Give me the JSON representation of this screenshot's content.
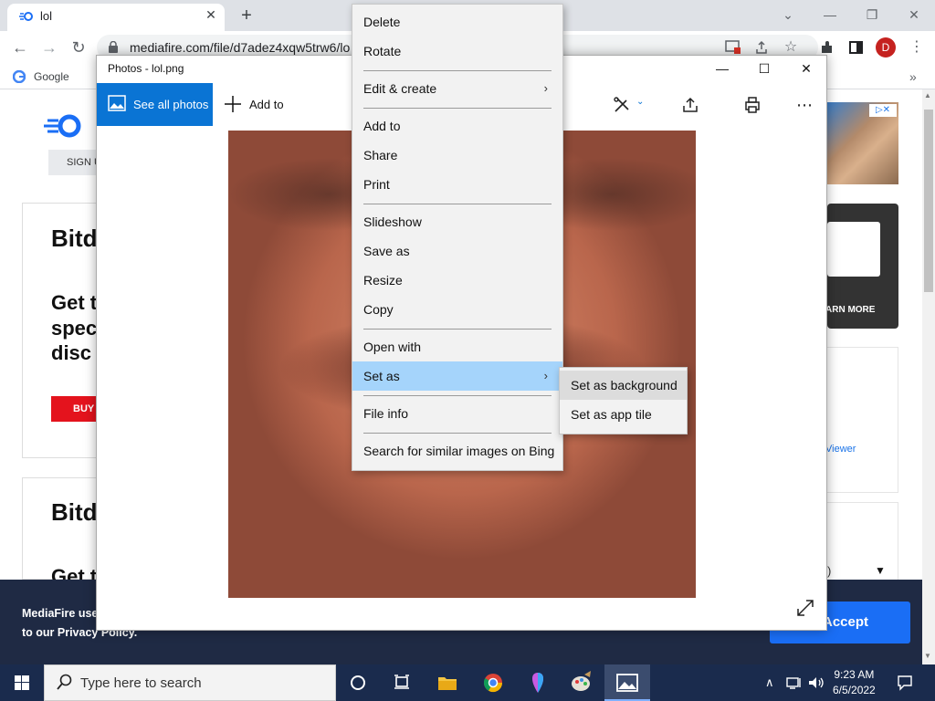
{
  "browser": {
    "tab_title": "lol",
    "tab_close": "✕",
    "new_tab": "+",
    "window_controls": {
      "minimize": "—",
      "restore": "❐",
      "close": "✕",
      "tab_search": "⌄"
    },
    "nav": {
      "back": "←",
      "forward": "→",
      "reload": "↻"
    },
    "url": "mediafire.com/file/d7adez4xqw5trw6/lo",
    "bookmark_google": "Google",
    "bookmarks_more": "»",
    "profile_initial": "D"
  },
  "mediafire": {
    "signup": "SIGN U",
    "card1_heading": "Bitd",
    "card1_body": [
      "Get t",
      "spec",
      "disc"
    ],
    "buy_label": "BUY",
    "card2_heading": "Bitd",
    "card2_body": "Get t",
    "learn_more": "ARN MORE",
    "viewer_link": "Viewer",
    "select_value": ")",
    "cookie_text_line1": "MediaFire use",
    "cookie_text_line2": "to our Privacy Policy.",
    "accept_label": "Accept"
  },
  "photos": {
    "title": "Photos - lol.png",
    "see_all_photos": "See all photos",
    "add_to": "Add to",
    "controls": {
      "minimize": "—",
      "maximize": "☐",
      "close": "✕"
    }
  },
  "context_menu": {
    "items": [
      {
        "label": "Delete"
      },
      {
        "label": "Rotate"
      },
      {
        "label": "Edit & create",
        "submenu": true
      },
      {
        "label": "Add to"
      },
      {
        "label": "Share"
      },
      {
        "label": "Print"
      },
      {
        "label": "Slideshow"
      },
      {
        "label": "Save as"
      },
      {
        "label": "Resize"
      },
      {
        "label": "Copy"
      },
      {
        "label": "Open with"
      },
      {
        "label": "Set as",
        "submenu": true,
        "selected": true
      },
      {
        "label": "File info"
      },
      {
        "label": "Search for similar images on Bing"
      }
    ],
    "chevron": "›"
  },
  "set_as_submenu": {
    "items": [
      "Set as background",
      "Set as app tile"
    ]
  },
  "taskbar": {
    "search_placeholder": "Type here to search",
    "time": "9:23 AM",
    "date": "6/5/2022"
  },
  "colors": {
    "accent": "#0a74d4",
    "menu_selected": "#a5d4fb",
    "taskbar": "#1a2b4d",
    "accept_button": "#1a6ef5"
  }
}
